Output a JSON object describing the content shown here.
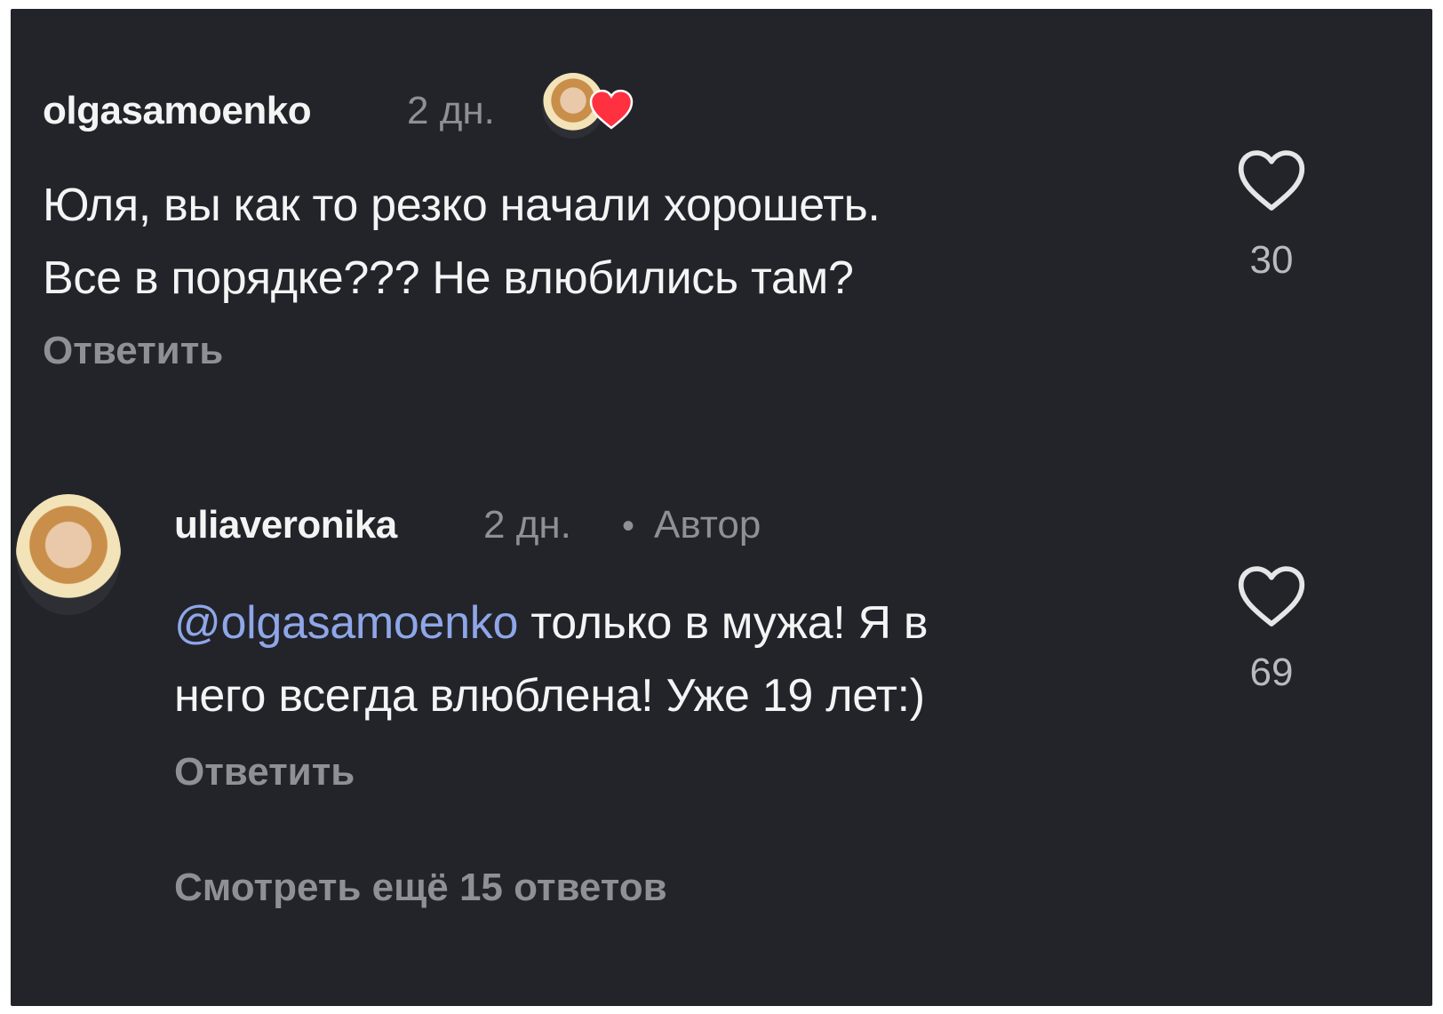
{
  "comments": [
    {
      "username": "olgasamoenko",
      "time": "2 дн.",
      "text_line1": "Юля, вы как то резко начали хорошеть.",
      "text_line2": "Все в порядке??? Не влюбились там?",
      "reply_label": "Ответить",
      "likes": "30",
      "like_icon": "heart-outline-icon",
      "liked_by_author_icon": "avatar-with-heart-icon"
    },
    {
      "username": "uliaveronika",
      "time": "2 дн.",
      "separator": "•",
      "badge": "Автор",
      "mention": "@olgasamoenko",
      "text_line1_rest": "только в мужа! Я в",
      "text_line2": "него всегда влюблена! Уже 19 лет:)",
      "reply_label": "Ответить",
      "likes": "69",
      "like_icon": "heart-outline-icon",
      "avatar_icon": "user-avatar-icon"
    }
  ],
  "view_more_label": "Смотреть ещё 15 ответов",
  "colors": {
    "background": "#222429",
    "text": "#f4f4f5",
    "muted": "#8e9096",
    "mention": "#8fa6e8",
    "heart_red": "#ff3040"
  }
}
